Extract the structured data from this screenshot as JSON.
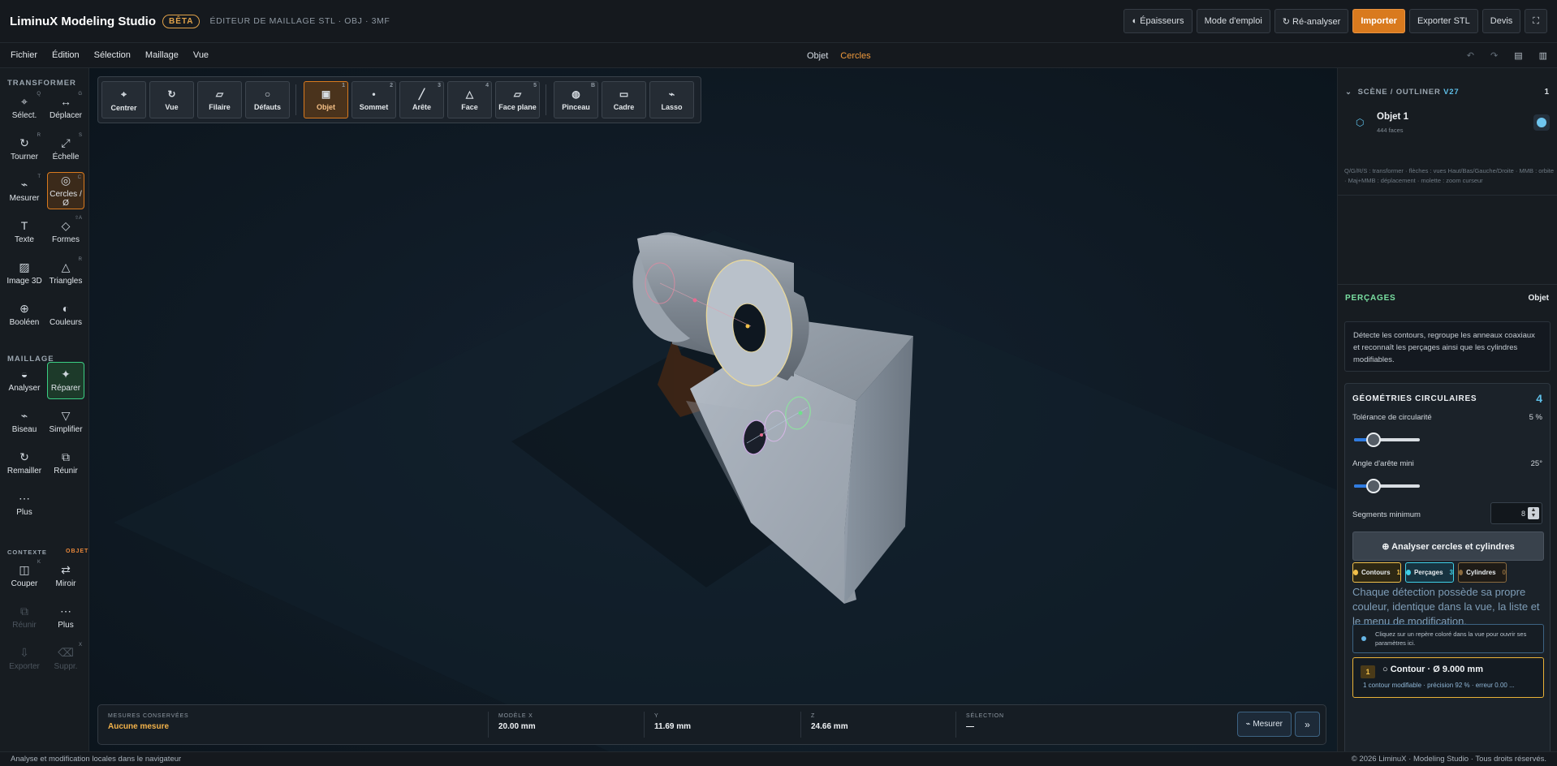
{
  "header": {
    "brand": "LiminuX Modeling Studio",
    "badge": "BÊTA",
    "subtitle": "ÉDITEUR DE MAILLAGE STL · OBJ · 3MF",
    "buttons": [
      {
        "label": "◐ Épaisseurs",
        "icon": "thickness-icon"
      },
      {
        "label": "Mode d'emploi",
        "icon": ""
      },
      {
        "label": "↻ Ré-analyser",
        "icon": "refresh-icon"
      },
      {
        "label": "Importer",
        "icon": "",
        "primary": true
      },
      {
        "label": "Exporter STL",
        "icon": ""
      },
      {
        "label": "Devis",
        "icon": ""
      },
      {
        "label": "⛶",
        "icon": "fullscreen-icon"
      }
    ]
  },
  "menu": {
    "items": [
      "Fichier",
      "Édition",
      "Sélection",
      "Maillage",
      "Vue"
    ],
    "mode_label": "Objet",
    "mode_current": "Cercles",
    "right_icons": [
      "undo-icon",
      "redo-icon",
      "panel-icon",
      "layout-icon"
    ]
  },
  "sidebar": {
    "section_transform": "TRANSFORMER",
    "section_mesh": "MAILLAGE",
    "section_context": "CONTEXTE",
    "context_tag": "OBJET",
    "tools": [
      {
        "label": "Sélect.",
        "key": "Q",
        "icon": "select-icon",
        "glyph": "⌖"
      },
      {
        "label": "Déplacer",
        "key": "G",
        "icon": "move-icon",
        "glyph": "↔"
      },
      {
        "label": "Tourner",
        "key": "R",
        "icon": "rotate-icon",
        "glyph": "↻"
      },
      {
        "label": "Échelle",
        "key": "S",
        "icon": "scale-icon",
        "glyph": "⤢"
      },
      {
        "label": "Mesurer",
        "key": "T",
        "icon": "measure-icon",
        "glyph": "⌁"
      },
      {
        "label": "Cercles / Ø",
        "key": "C",
        "icon": "circles-icon",
        "glyph": "◎",
        "active": true
      },
      {
        "label": "Texte",
        "key": "",
        "icon": "text-icon",
        "glyph": "T"
      },
      {
        "label": "Formes",
        "key": "⇧A",
        "icon": "shapes-icon",
        "glyph": "◇"
      },
      {
        "label": "Image 3D",
        "key": "",
        "icon": "image3d-icon",
        "glyph": "▨"
      },
      {
        "label": "Triangles",
        "key": "R",
        "icon": "triangles-icon",
        "glyph": "△"
      },
      {
        "label": "Booléen",
        "key": "",
        "icon": "boolean-icon",
        "glyph": "⊕"
      },
      {
        "label": "Couleurs",
        "key": "",
        "icon": "colors-icon",
        "glyph": "◐"
      },
      {
        "label": "Analyser",
        "key": "",
        "icon": "analyze-icon",
        "glyph": "◒"
      },
      {
        "label": "Réparer",
        "key": "",
        "icon": "repair-icon",
        "glyph": "✦",
        "ok": true
      },
      {
        "label": "Biseau",
        "key": "",
        "icon": "bevel-icon",
        "glyph": "⌁"
      },
      {
        "label": "Simplifier",
        "key": "",
        "icon": "simplify-icon",
        "glyph": "▽"
      },
      {
        "label": "Remailler",
        "key": "",
        "icon": "remesh-icon",
        "glyph": "↻"
      },
      {
        "label": "Réunir",
        "key": "",
        "icon": "merge-icon",
        "glyph": "⧉"
      },
      {
        "label": "Plus",
        "key": "",
        "icon": "more-icon",
        "glyph": "⋯"
      },
      {
        "label": "Couper",
        "key": "K",
        "icon": "cut-icon",
        "glyph": "◫"
      },
      {
        "label": "Miroir",
        "key": "",
        "icon": "mirror-icon",
        "glyph": "⇄"
      },
      {
        "label": "Réunir",
        "key": "",
        "icon": "merge-disabled-icon",
        "glyph": "⧉",
        "disabled": true
      },
      {
        "label": "Plus",
        "key": "",
        "icon": "more-icon",
        "glyph": "⋯"
      },
      {
        "label": "Exporter",
        "key": "",
        "icon": "export-icon",
        "glyph": "⇩",
        "disabled": true
      },
      {
        "label": "Suppr.",
        "key": "X",
        "icon": "delete-icon",
        "glyph": "⌫",
        "disabled": true
      }
    ]
  },
  "viewport_toolbar": [
    {
      "label": "Centrer",
      "key": "",
      "glyph": "⌖",
      "icon": "center-icon"
    },
    {
      "label": "Vue",
      "key": "",
      "glyph": "↻",
      "icon": "view-icon"
    },
    {
      "label": "Filaire",
      "key": "",
      "glyph": "▱",
      "icon": "wireframe-icon"
    },
    {
      "label": "Défauts",
      "key": "",
      "glyph": "○",
      "icon": "defects-icon"
    },
    {
      "label": "Objet",
      "key": "1",
      "glyph": "▣",
      "icon": "object-icon",
      "active": true
    },
    {
      "label": "Sommet",
      "key": "2",
      "glyph": "•",
      "icon": "vertex-icon"
    },
    {
      "label": "Arête",
      "key": "3",
      "glyph": "╱",
      "icon": "edge-icon"
    },
    {
      "label": "Face",
      "key": "4",
      "glyph": "△",
      "icon": "face-icon"
    },
    {
      "label": "Face plane",
      "key": "5",
      "glyph": "▱",
      "icon": "flat-face-icon"
    },
    {
      "label": "Pinceau",
      "key": "B",
      "glyph": "◍",
      "icon": "brush-icon"
    },
    {
      "label": "Cadre",
      "key": "",
      "glyph": "▭",
      "icon": "frame-icon"
    },
    {
      "label": "Lasso",
      "key": "",
      "glyph": "⌁",
      "icon": "lasso-icon"
    }
  ],
  "measurements": {
    "saved_label": "MESURES CONSERVÉES",
    "saved_value": "Aucune mesure",
    "x_label": "MODÈLE X",
    "x_value": "20.00 mm",
    "y_label": "Y",
    "y_value": "11.69 mm",
    "z_label": "Z",
    "z_value": "24.66 mm",
    "sel_label": "SÉLECTION",
    "sel_value": "—",
    "measure_button": "⌁ Mesurer",
    "next_button": "»"
  },
  "outliner": {
    "title": "SCÈNE / OUTLINER",
    "version": "V27",
    "count": "1",
    "object_name": "Objet 1",
    "object_faces": "444 faces",
    "hint": "Q/G/R/S : transformer · flèches : vues Haut/Bas/Gauche/Droite · MMB : orbite · Maj+MMB : déplacement · molette : zoom curseur"
  },
  "holes": {
    "title": "PERÇAGES",
    "scope": "Objet",
    "description": "Détecte les contours, regroupe les anneaux coaxiaux et reconnaît les perçages ainsi que les cylindres modifiables.",
    "geo_title": "GÉOMÉTRIES CIRCULAIRES",
    "geo_count": "4",
    "tolerance_label": "Tolérance de circularité",
    "tolerance_value": "5 %",
    "tolerance_level": 0.3,
    "angle_label": "Angle d'arête mini",
    "angle_value": "25°",
    "angle_level": 0.3,
    "segments_label": "Segments minimum",
    "segments_value": "8",
    "analyze_button": "⊕ Analyser cercles et cylindres",
    "chips": [
      {
        "label": "Contours",
        "count": "1",
        "color": "#f2c04a"
      },
      {
        "label": "Perçages",
        "count": "3",
        "color": "#3fd0e8"
      },
      {
        "label": "Cylindres",
        "count": "0",
        "color": "#8a6a3e"
      }
    ],
    "legend_text": "Chaque détection possède sa propre couleur, identique dans la vue, la liste et le menu de modification.",
    "info_text": "Cliquez sur un repère coloré dans la vue pour ouvrir ses paramètres ici.",
    "card_index": "1",
    "card_title": "○ Contour · Ø 9.000 mm",
    "card_sub": "1 contour modifiable · précision 92 % · erreur 0.00 ..."
  },
  "footer": {
    "left": "Analyse et modification locales dans le navigateur",
    "right": "© 2026 LiminuX · Modeling Studio · Tous droits réservés."
  },
  "colors": {
    "accent": "#d97a1e",
    "repair": "#3bcf84",
    "holes": "#3fd0e8",
    "contour": "#f2c04a"
  }
}
